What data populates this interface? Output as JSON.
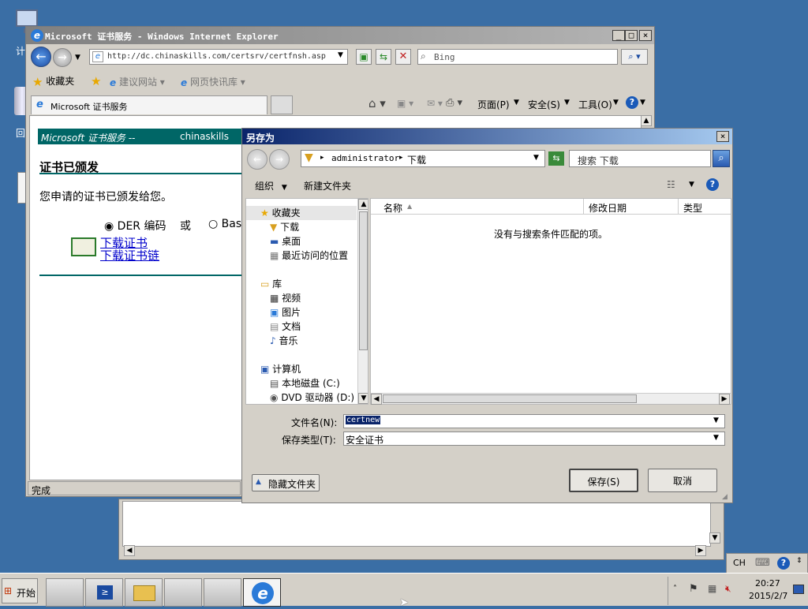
{
  "desktop": {
    "icon1_label": "计",
    "icon2_label": "回"
  },
  "ie": {
    "title": "Microsoft 证书服务 - Windows Internet Explorer",
    "address": "http://dc.chinaskills.com/certsrv/certfnsh.asp",
    "search_placeholder": "Bing",
    "favorites_label": "收藏夹",
    "suggested_sites": "建议网站",
    "web_slices": "网页快讯库",
    "tab_label": "Microsoft 证书服务",
    "cmd_page": "页面(P)",
    "cmd_safety": "安全(S)",
    "cmd_tools": "工具(O)",
    "status": "完成",
    "page": {
      "banner_left": "Microsoft 证书服务 --",
      "banner_right": "chinaskills",
      "heading": "证书已颁发",
      "message": "您申请的证书已颁发给您。",
      "radio_der": "DER 编码",
      "or_text": "或",
      "radio_base": "Bas",
      "link_cert": "下载证书",
      "link_chain": "下载证书链"
    }
  },
  "dialog": {
    "title": "另存为",
    "breadcrumb_1": "administrator",
    "breadcrumb_2": "下载",
    "search_placeholder": "搜索 下载",
    "organize": "组织",
    "new_folder": "新建文件夹",
    "nav": {
      "favorites": "收藏夹",
      "downloads": "下载",
      "desktop": "桌面",
      "recent": "最近访问的位置",
      "libraries": "库",
      "videos": "视频",
      "pictures": "图片",
      "documents": "文档",
      "music": "音乐",
      "computer": "计算机",
      "local_disk": "本地磁盘 (C:)",
      "dvd": "DVD 驱动器 (D:)"
    },
    "columns": [
      "名称",
      "修改日期",
      "类型"
    ],
    "empty_message": "没有与搜索条件匹配的项。",
    "filename_label": "文件名(N):",
    "filename_value": "certnew",
    "filetype_label": "保存类型(T):",
    "filetype_value": "安全证书",
    "hide_folders": "隐藏文件夹",
    "save": "保存(S)",
    "cancel": "取消"
  },
  "taskbar": {
    "start": "开始",
    "lang": "CH",
    "time": "20:27",
    "date": "2015/2/7"
  },
  "colors": {
    "desktop": "#3a6ea5",
    "ie_banner": "#006666",
    "link": "#0000cc"
  }
}
